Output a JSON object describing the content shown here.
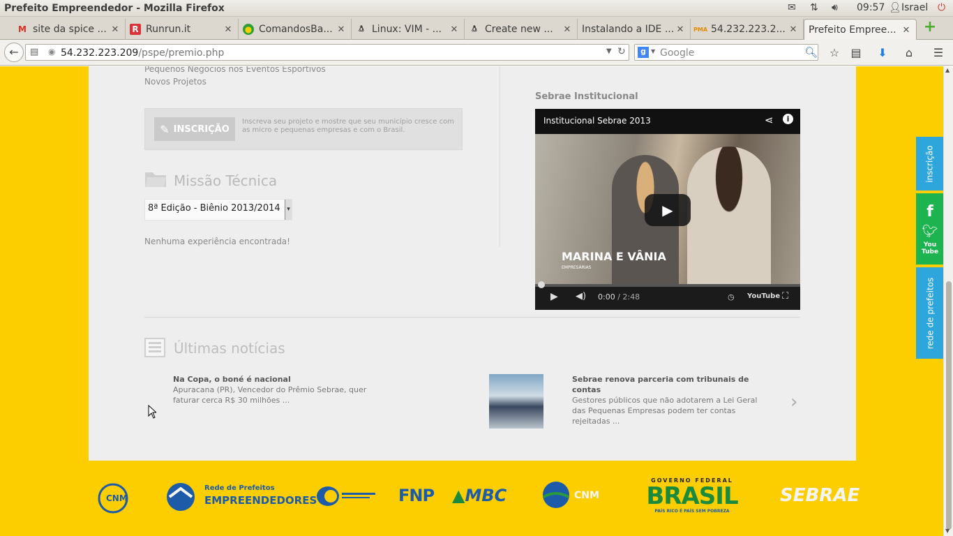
{
  "os_bar": {
    "window_title": "Prefeito Empreendedor - Mozilla Firefox",
    "time": "09:57",
    "user": "Israel"
  },
  "tabs": [
    {
      "label": "site da spice ...",
      "icon": "gmail-icon",
      "active": false
    },
    {
      "label": "Runrun.it",
      "icon": "runrun-icon",
      "active": false
    },
    {
      "label": "ComandosBa...",
      "icon": "comandos-icon",
      "active": false
    },
    {
      "label": "Linux: VIM - ...",
      "icon": "linux-icon",
      "active": false
    },
    {
      "label": "Create new ...",
      "icon": "linux-icon",
      "active": false
    },
    {
      "label": "Instalando a IDE ...",
      "icon": "page-icon",
      "active": false
    },
    {
      "label": "54.232.223.2...",
      "icon": "pma-icon",
      "active": false
    },
    {
      "label": "Prefeito Empree...",
      "icon": "page-icon",
      "active": true
    }
  ],
  "navbar": {
    "url_host": "54.232.223.209",
    "url_path": "/pspe/premio.php",
    "search_placeholder": "Google"
  },
  "page": {
    "menu_links": [
      "Pequenos Negócios nos Eventos Esportivos",
      "Novos Projetos"
    ],
    "inscricao": {
      "button_label": "INSCRIÇÃO",
      "text": "Inscreva seu projeto e mostre que seu município cresce com as micro e pequenas empresas e com o Brasil."
    },
    "missao": {
      "title": "Missão Técnica",
      "select_value": "8ª Edição - Biênio 2013/2014",
      "empty_text": "Nenhuma experiência encontrada!"
    },
    "sebrae_institucional": {
      "heading": "Sebrae Institucional",
      "video_title": "Institucional Sebrae 2013",
      "caption": "MARINA E VÂNIA",
      "caption_sub": "EMPRESÁRIAS",
      "time_current": "0:00",
      "time_total": "/ 2:48",
      "youtube_label": "YouTube"
    },
    "noticias": {
      "title": "Últimas notícias",
      "items": [
        {
          "headline": "Na Copa, o boné é nacional",
          "body": "Apuracana (PR), Vencedor do Prêmio Sebrae, quer faturar cerca R$ 30 milhões ..."
        },
        {
          "headline": "Sebrae renova parceria com tribunais de contas",
          "body": "Gestores públicos que não adotarem a Lei Geral das Pequenas Empresas podem ter contas rejeitadas ..."
        }
      ]
    },
    "sidebar": {
      "inscricao": "inscrição",
      "rede": "rede de prefeitos",
      "youtube": "You Tube"
    },
    "footer_logos": [
      "CNM 25",
      "Rede de Prefeitos",
      "EMPREENDEDORES",
      "FNP",
      "MBC",
      "CNM",
      "GOVERNO FEDERAL",
      "BRASIL",
      "PAÍS RICO É PAÍS SEM POBREZA",
      "SEBRAE"
    ]
  }
}
